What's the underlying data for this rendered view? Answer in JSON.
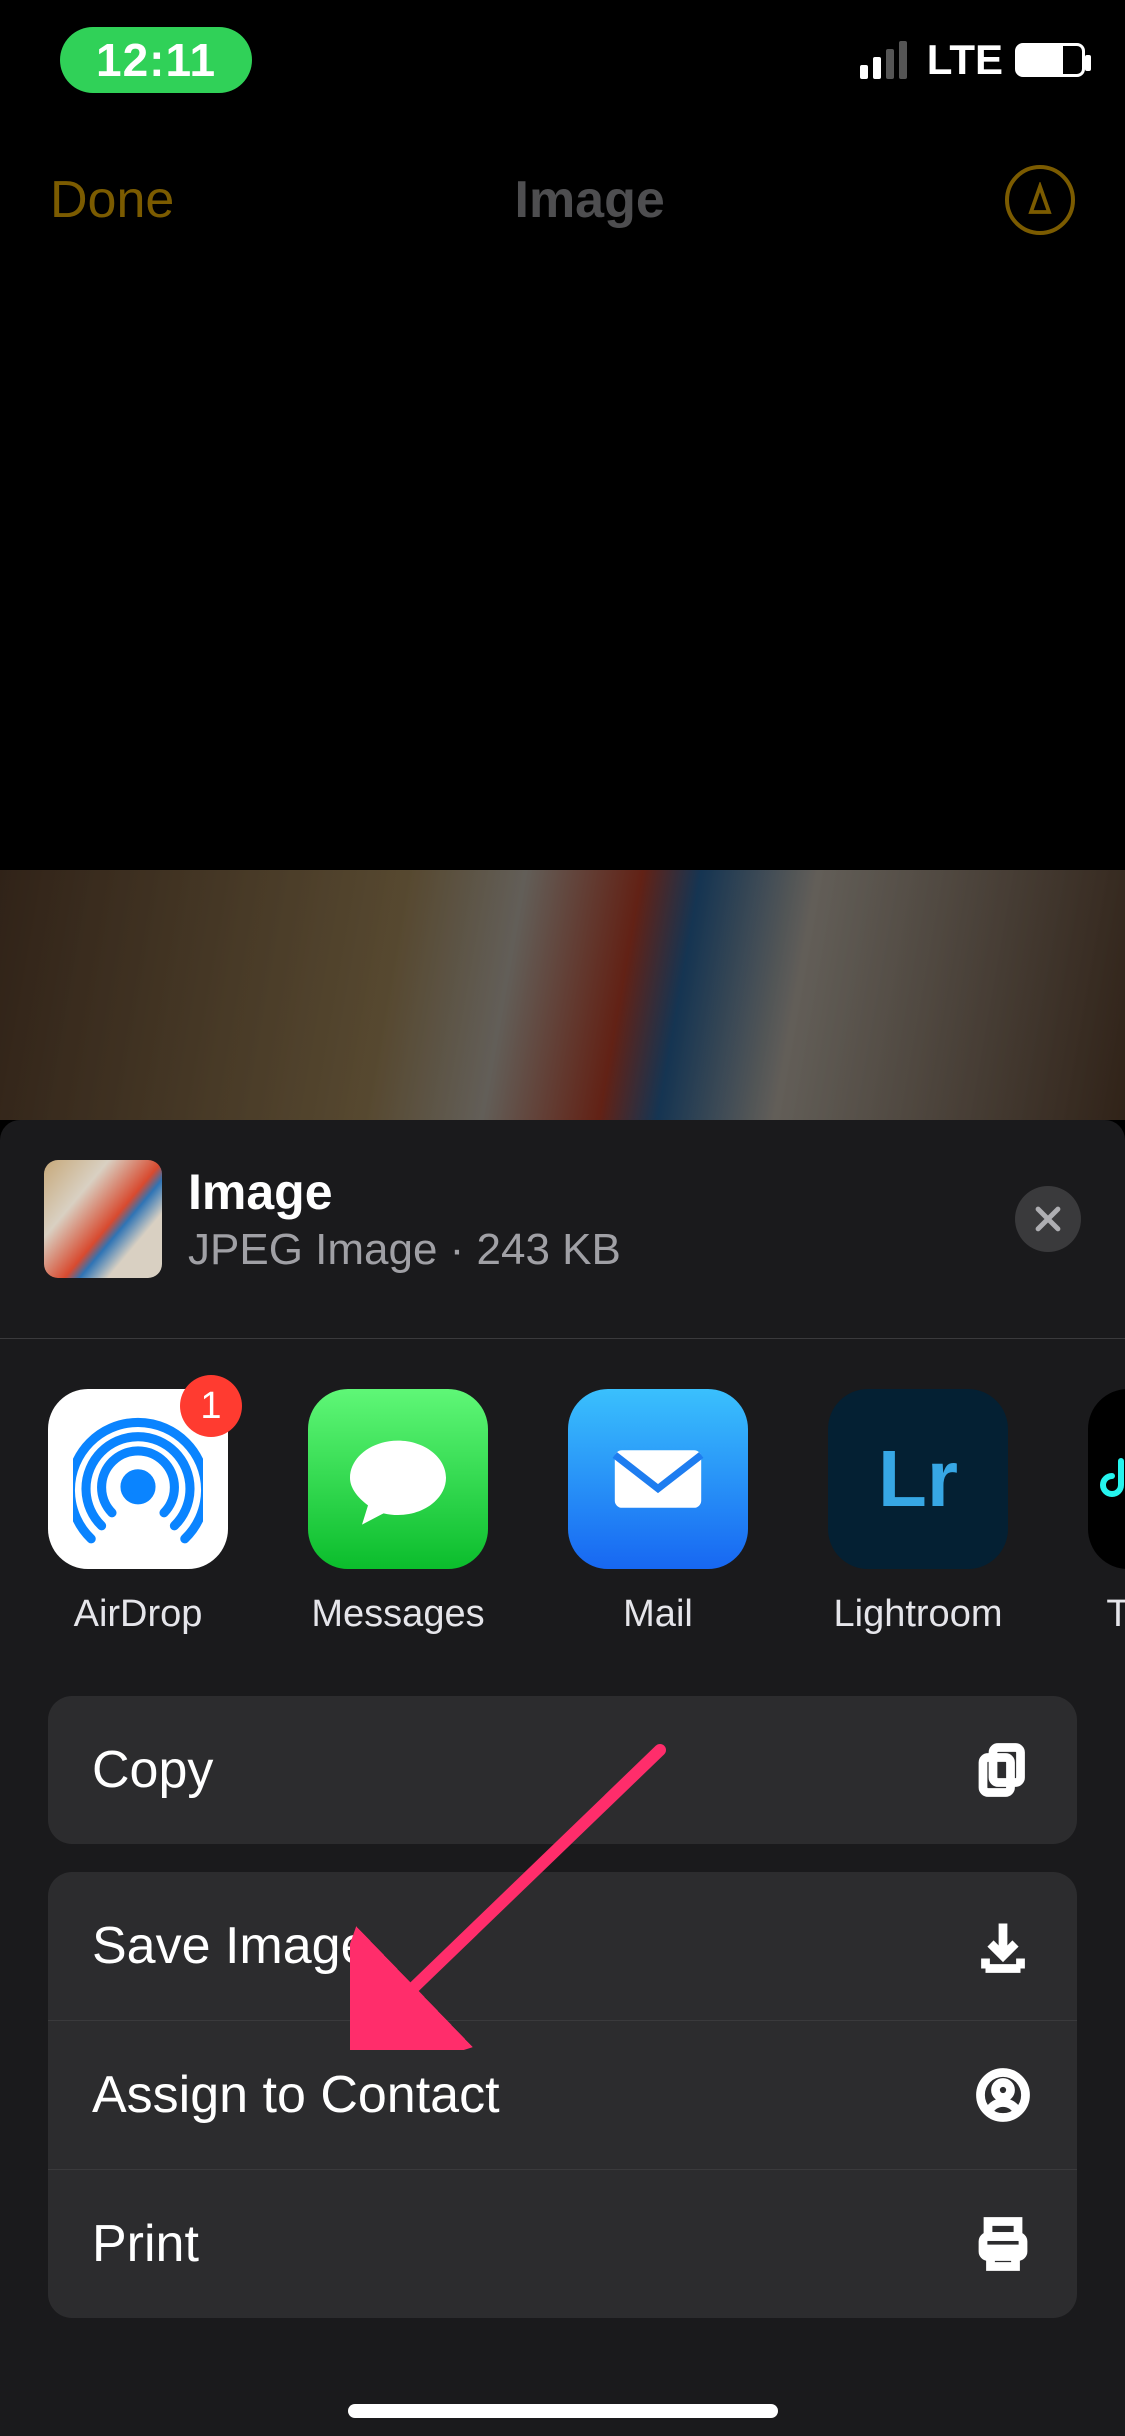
{
  "status": {
    "time": "12:11",
    "network": "LTE"
  },
  "nav": {
    "done": "Done",
    "title": "Image"
  },
  "sheet": {
    "title": "Image",
    "type": "JPEG Image",
    "size": "243 KB"
  },
  "apps": {
    "airdrop": {
      "label": "AirDrop",
      "badge": "1"
    },
    "messages": {
      "label": "Messages"
    },
    "mail": {
      "label": "Mail"
    },
    "lightroom": {
      "label": "Lightroom"
    },
    "tiktok": {
      "label": "T"
    }
  },
  "actions": {
    "copy": "Copy",
    "save": "Save Image",
    "assign": "Assign to Contact",
    "print": "Print"
  }
}
